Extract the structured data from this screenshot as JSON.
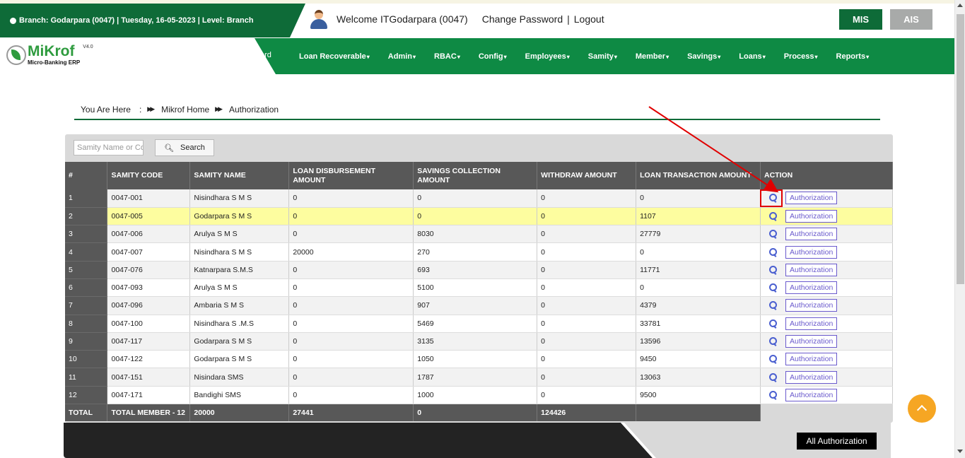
{
  "header": {
    "branch_info": "Branch: Godarpara (0047) | Tuesday, 16-05-2023 | Level: Branch",
    "welcome": "Welcome ITGodarpara (0047)",
    "change_password": "Change Password",
    "separator": "|",
    "logout": "Logout",
    "mis": "MIS",
    "ais": "AIS"
  },
  "logo": {
    "name": "MiKrof",
    "subtitle": "Micro-Banking ERP",
    "version": "V4.0"
  },
  "nav": {
    "partial": "ard",
    "items": [
      {
        "label": "Loan Recoverable",
        "caret": "▾"
      },
      {
        "label": "Admin",
        "caret": "▾"
      },
      {
        "label": "RBAC",
        "caret": "▾"
      },
      {
        "label": "Config",
        "caret": "▾"
      },
      {
        "label": "Employees",
        "caret": "▾"
      },
      {
        "label": "Samity",
        "caret": "▾"
      },
      {
        "label": "Member",
        "caret": "▾"
      },
      {
        "label": "Savings",
        "caret": "▾"
      },
      {
        "label": "Loans",
        "caret": "▾"
      },
      {
        "label": "Process",
        "caret": "▾"
      },
      {
        "label": "Reports",
        "caret": "▾"
      }
    ]
  },
  "breadcrumb": {
    "label": "You Are Here",
    "colon": ":",
    "home": "Mikrof Home",
    "current": "Authorization",
    "sep": "▶▶"
  },
  "search": {
    "placeholder": "Samity Name or Code",
    "button": "Search"
  },
  "table": {
    "headers": [
      "#",
      "SAMITY CODE",
      "SAMITY NAME",
      "LOAN DISBURSEMENT AMOUNT",
      "SAVINGS COLLECTION AMOUNT",
      "WITHDRAW AMOUNT",
      "LOAN TRANSACTION AMOUNT",
      "ACTION"
    ],
    "action_label": "Authorization",
    "rows": [
      [
        "1",
        "0047-001",
        "Nisindhara S M S",
        "0",
        "0",
        "0",
        "0"
      ],
      [
        "2",
        "0047-005",
        "Godarpara S M S",
        "0",
        "0",
        "0",
        "1107"
      ],
      [
        "3",
        "0047-006",
        "Arulya S M S",
        "0",
        "8030",
        "0",
        "27779"
      ],
      [
        "4",
        "0047-007",
        "Nisindhara S M S",
        "20000",
        "270",
        "0",
        "0"
      ],
      [
        "5",
        "0047-076",
        "Katnarpara S.M.S",
        "0",
        "693",
        "0",
        "11771"
      ],
      [
        "6",
        "0047-093",
        "Arulya S M S",
        "0",
        "5100",
        "0",
        "0"
      ],
      [
        "7",
        "0047-096",
        "Ambaria S M S",
        "0",
        "907",
        "0",
        "4379"
      ],
      [
        "8",
        "0047-100",
        "Nisindhara S .M.S",
        "0",
        "5469",
        "0",
        "33781"
      ],
      [
        "9",
        "0047-117",
        "Godarpara S M S",
        "0",
        "3135",
        "0",
        "13596"
      ],
      [
        "10",
        "0047-122",
        "Godarpara S M S",
        "0",
        "1050",
        "0",
        "9450"
      ],
      [
        "11",
        "0047-151",
        "Nisindara SMS",
        "0",
        "1787",
        "0",
        "13063"
      ],
      [
        "12",
        "0047-171",
        "Bandighi SMS",
        "0",
        "1000",
        "0",
        "9500"
      ]
    ],
    "total": [
      "TOTAL",
      "TOTAL MEMBER - 12",
      "20000",
      "27441",
      "0",
      "124426"
    ]
  },
  "footer": {
    "all_authorization": "All Authorization"
  },
  "colors": {
    "primary_green": "#0e6b38",
    "nav_green": "#0e8a44",
    "highlight_row": "#fdfd9f",
    "accent_orange": "#f6a623",
    "annotation_red": "#e00000"
  }
}
